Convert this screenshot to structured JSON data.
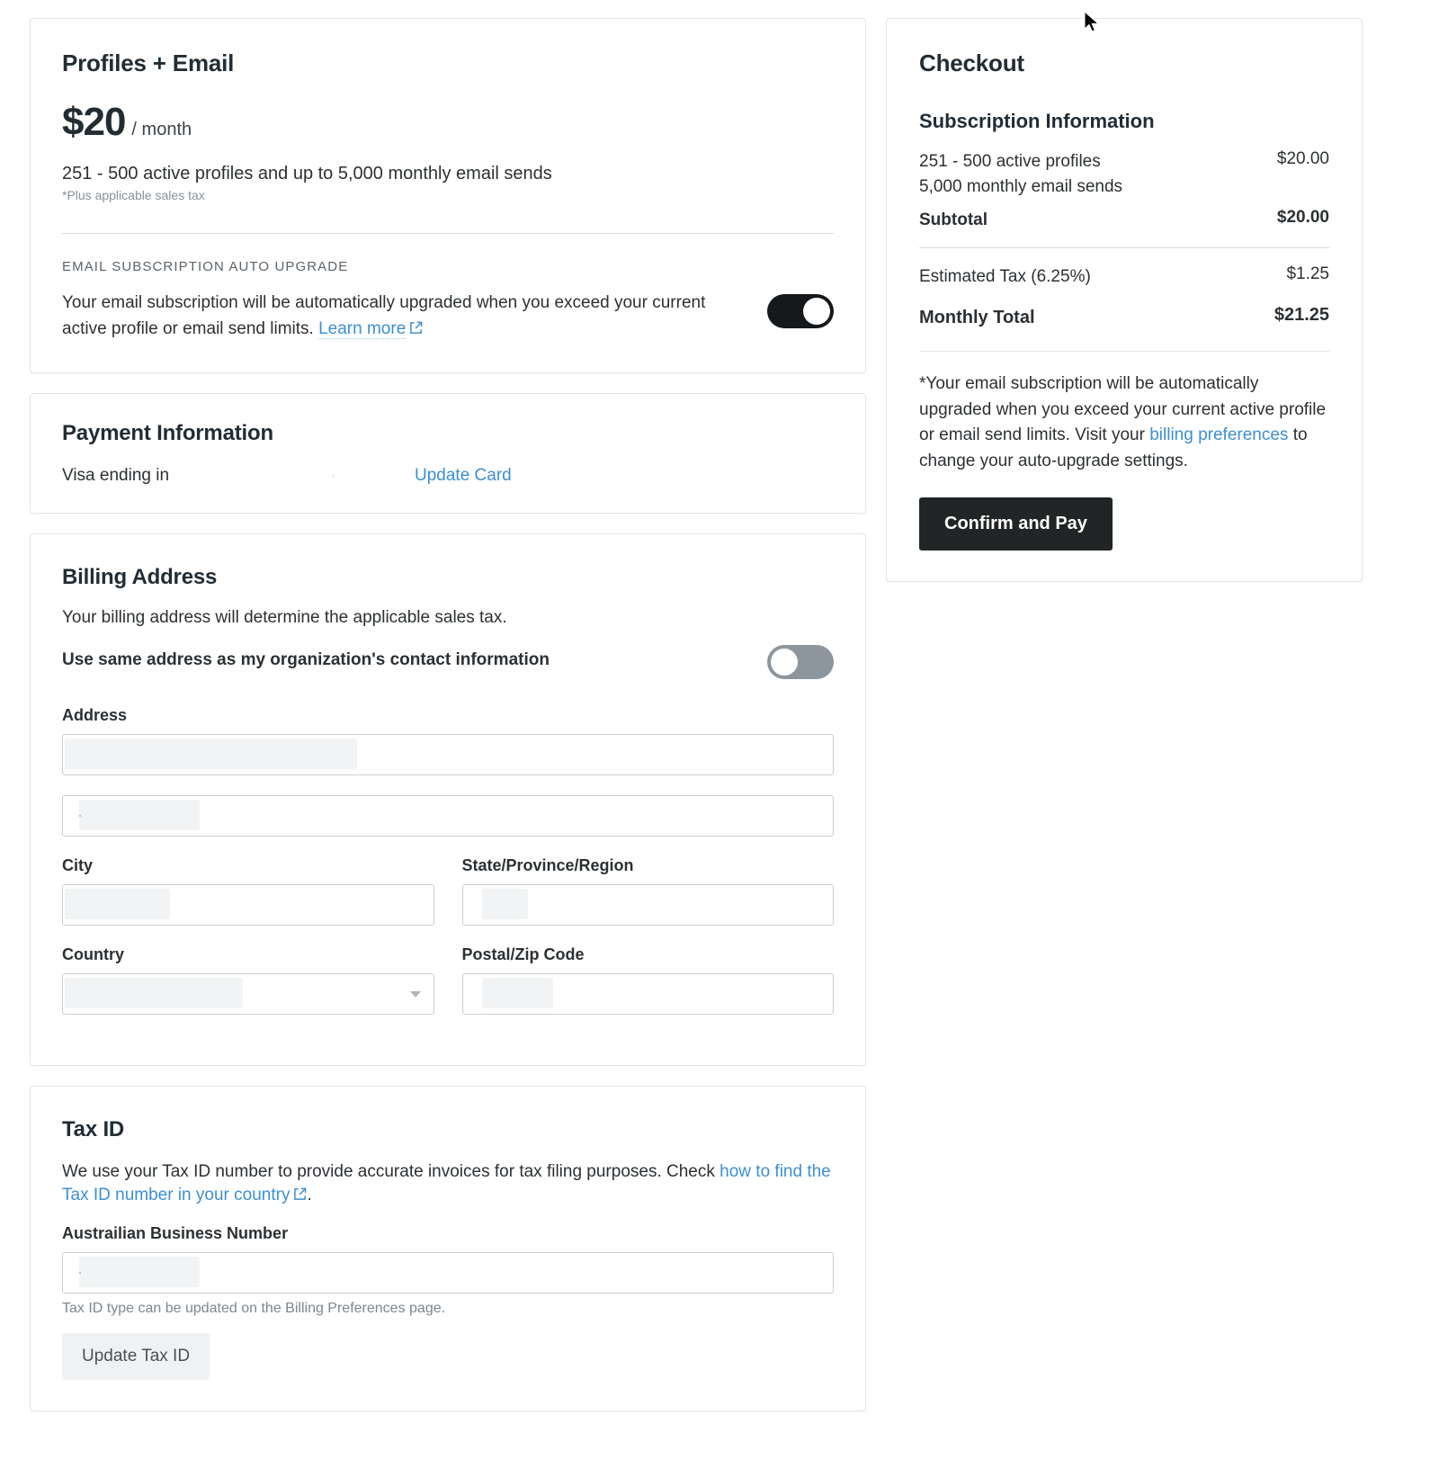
{
  "plan": {
    "title": "Profiles + Email",
    "price_amount": "$20",
    "price_period": "/ month",
    "description": "251 - 500 active profiles and up to 5,000 monthly email sends",
    "tax_note": "*Plus applicable sales tax",
    "auto_upgrade_kicker": "EMAIL SUBSCRIPTION AUTO UPGRADE",
    "auto_upgrade_text": "Your email subscription will be automatically upgraded when you exceed your current active profile or email send limits.",
    "auto_upgrade_link": "Learn more",
    "auto_upgrade_toggle_state": "on"
  },
  "payment": {
    "title": "Payment Information",
    "card_label": "Visa ending in",
    "card_last4": "",
    "update_link": "Update Card"
  },
  "billing": {
    "title": "Billing Address",
    "description": "Your billing address will determine the applicable sales tax.",
    "same_address_label": "Use same address as my organization's contact information",
    "same_address_toggle_state": "off",
    "address_label": "Address",
    "address_line1_value": "",
    "address_line2_value": "",
    "city_label": "City",
    "city_value": "",
    "state_label": "State/Province/Region",
    "state_value": "",
    "country_label": "Country",
    "country_value": "",
    "postal_label": "Postal/Zip Code",
    "postal_value": ""
  },
  "tax": {
    "title": "Tax ID",
    "description": "We use your Tax ID number to provide accurate invoices for tax filing purposes. Check",
    "description_link": "how to find the Tax ID number in your country",
    "description_end": ".",
    "field_label": "Austrailian Business Number",
    "field_value": "",
    "hint": "Tax ID type can be updated on the Billing Preferences page.",
    "button_label": "Update Tax ID"
  },
  "checkout": {
    "title": "Checkout",
    "subtitle": "Subscription Information",
    "items": [
      {
        "label_line1": "251 - 500 active profiles",
        "label_line2": "5,000 monthly email sends",
        "value": "$20.00"
      }
    ],
    "subtotal_label": "Subtotal",
    "subtotal_value": "$20.00",
    "tax_label": "Estimated Tax (6.25%)",
    "tax_value": "$1.25",
    "total_label": "Monthly Total",
    "total_value": "$21.25",
    "footnote_part1": "*Your email subscription will be automatically upgraded when you exceed your current active profile or email send limits. Visit your",
    "footnote_link": "billing preferences",
    "footnote_part2": "to change your auto-upgrade settings.",
    "confirm_button": "Confirm and Pay"
  },
  "colors": {
    "accent_link": "#3d8fd1",
    "primary_button": "#222526",
    "toggle_on": "#16191c",
    "toggle_off": "#8d969c"
  }
}
